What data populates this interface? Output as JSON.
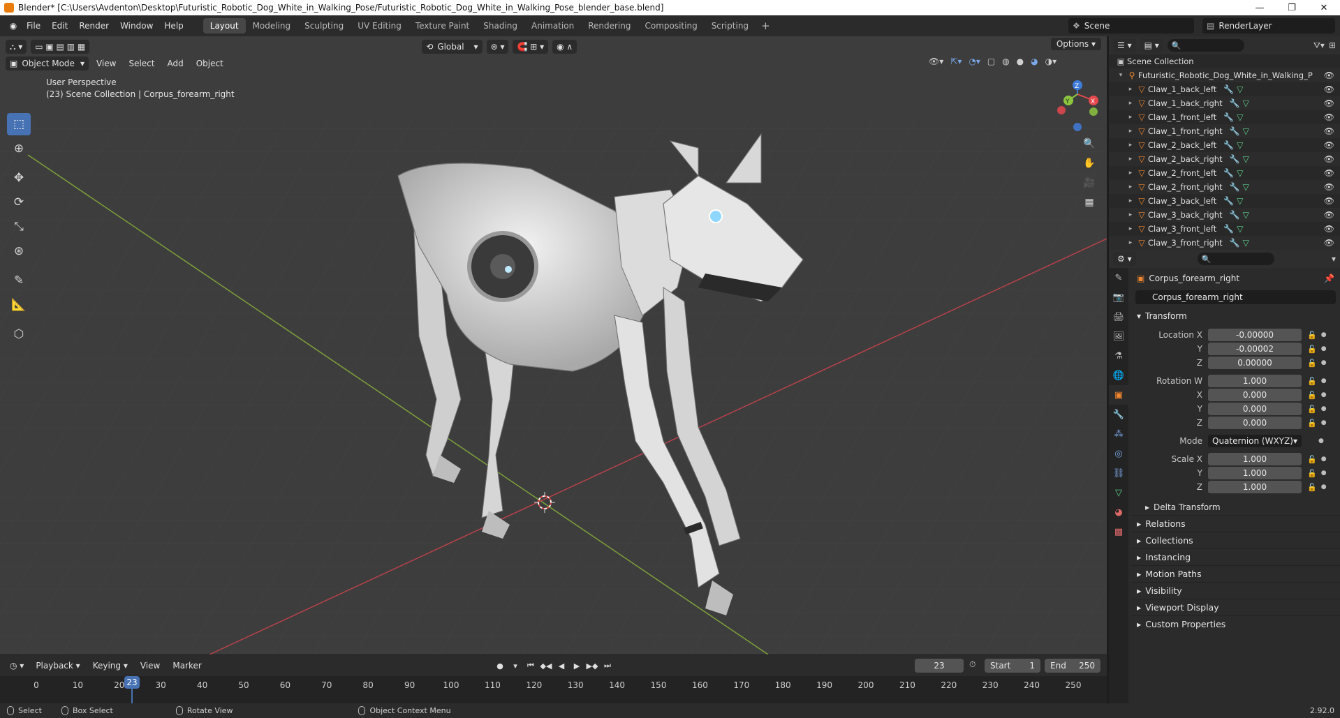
{
  "window": {
    "title": "Blender* [C:\\Users\\Avdenton\\Desktop\\Futuristic_Robotic_Dog_White_in_Walking_Pose/Futuristic_Robotic_Dog_White_in_Walking_Pose_blender_base.blend]",
    "minimize": "—",
    "maximize": "❐",
    "close": "✕"
  },
  "menus": [
    "File",
    "Edit",
    "Render",
    "Window",
    "Help"
  ],
  "workspaces": [
    "Layout",
    "Modeling",
    "Sculpting",
    "UV Editing",
    "Texture Paint",
    "Shading",
    "Animation",
    "Rendering",
    "Compositing",
    "Scripting"
  ],
  "active_workspace": "Layout",
  "scene": "Scene",
  "view_layer": "RenderLayer",
  "viewport": {
    "transform_orientation": "Global",
    "mode": "Object Mode",
    "menus": [
      "View",
      "Select",
      "Add",
      "Object"
    ],
    "options": "Options",
    "info_line1": "User Perspective",
    "info_line2": "(23) Scene Collection | Corpus_forearm_right",
    "gizmo": {
      "x": "X",
      "y": "Y",
      "z": "Z"
    }
  },
  "tools": [
    "select-box",
    "cursor",
    "move",
    "rotate",
    "scale",
    "transform",
    "annotate",
    "measure",
    "add-cube"
  ],
  "outliner": {
    "root": "Scene Collection",
    "collection": "Futuristic_Robotic_Dog_White_in_Walking_P",
    "items": [
      "Claw_1_back_left",
      "Claw_1_back_right",
      "Claw_1_front_left",
      "Claw_1_front_right",
      "Claw_2_back_left",
      "Claw_2_back_right",
      "Claw_2_front_left",
      "Claw_2_front_right",
      "Claw_3_back_left",
      "Claw_3_back_right",
      "Claw_3_front_left",
      "Claw_3_front_right"
    ]
  },
  "properties": {
    "object_name": "Corpus_forearm_right",
    "name_field": "Corpus_forearm_right",
    "transform_title": "Transform",
    "location": {
      "label": "Location X",
      "x": "-0.00000",
      "y": "-0.00002",
      "z": "0.00000"
    },
    "rotation": {
      "label": "Rotation W",
      "w": "1.000",
      "x": "0.000",
      "y": "0.000",
      "z": "0.000"
    },
    "mode_label": "Mode",
    "mode_value": "Quaternion (WXYZ)",
    "scale": {
      "label": "Scale X",
      "x": "1.000",
      "y": "1.000",
      "z": "1.000"
    },
    "axis_labels": {
      "y": "Y",
      "z": "Z",
      "x": "X"
    },
    "delta_transform": "Delta Transform",
    "panels": [
      "Relations",
      "Collections",
      "Instancing",
      "Motion Paths",
      "Visibility",
      "Viewport Display",
      "Custom Properties"
    ]
  },
  "timeline": {
    "menus": [
      "Playback",
      "Keying",
      "View",
      "Marker"
    ],
    "current_frame": "23",
    "start_label": "Start",
    "start": "1",
    "end_label": "End",
    "end": "250",
    "ruler": [
      "0",
      "10",
      "20",
      "30",
      "40",
      "50",
      "60",
      "70",
      "80",
      "90",
      "100",
      "110",
      "120",
      "130",
      "140",
      "150",
      "160",
      "170",
      "180",
      "190",
      "200",
      "210",
      "220",
      "230",
      "240",
      "250"
    ]
  },
  "status": {
    "select": "Select",
    "box_select": "Box Select",
    "rotate_view": "Rotate View",
    "context_menu": "Object Context Menu",
    "version": "2.92.0"
  },
  "colors": {
    "accent": "#4772b3",
    "object_orange": "#f0862d",
    "x_axis": "#e5484d",
    "y_axis": "#8cc63f",
    "z_axis": "#3f7bd9"
  }
}
